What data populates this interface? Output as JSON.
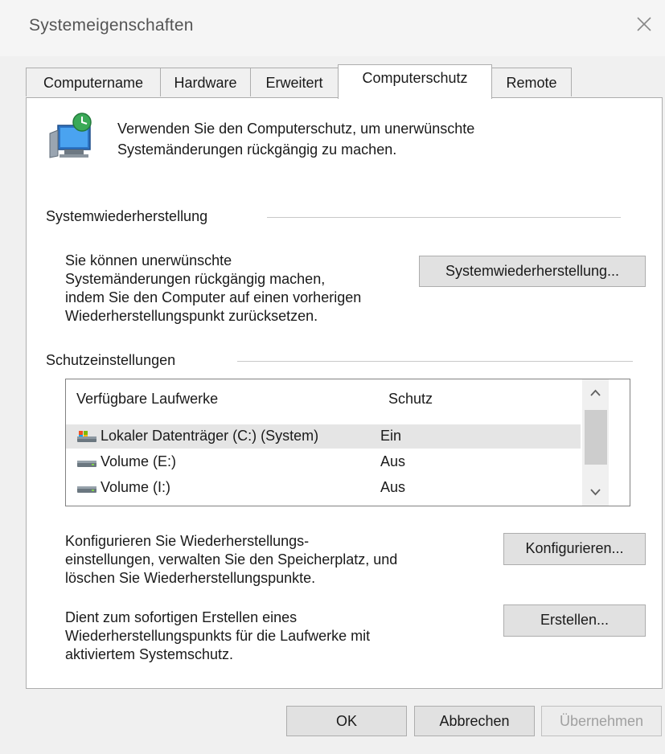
{
  "window": {
    "title": "Systemeigenschaften"
  },
  "tabs": [
    {
      "label": "Computername"
    },
    {
      "label": "Hardware"
    },
    {
      "label": "Erweitert"
    },
    {
      "label": "Computerschutz",
      "active": true
    },
    {
      "label": "Remote"
    }
  ],
  "intro": {
    "text_line1": "Verwenden Sie den Computerschutz, um unerwünschte",
    "text_line2": "Systemänderungen rückgängig zu machen."
  },
  "restore": {
    "group_label": "Systemwiederherstellung",
    "line1": "Sie können unerwünschte",
    "line2": "Systemänderungen rückgängig machen,",
    "line3": "indem Sie den Computer auf einen vorherigen",
    "line4": "Wiederherstellungspunkt zurücksetzen.",
    "button_label": "Systemwiederherstellung..."
  },
  "protection": {
    "group_label": "Schutzeinstellungen",
    "columns": {
      "drives": "Verfügbare Laufwerke",
      "status": "Schutz"
    },
    "drives": [
      {
        "name": "Lokaler Datenträger (C:) (System)",
        "status": "Ein",
        "icon": "system-drive-icon",
        "selected": true
      },
      {
        "name": "Volume (E:)",
        "status": "Aus",
        "icon": "drive-icon"
      },
      {
        "name": "Volume (I:)",
        "status": "Aus",
        "icon": "drive-icon"
      }
    ]
  },
  "configure": {
    "line1": "Konfigurieren Sie Wiederherstellungs-",
    "line2": "einstellungen, verwalten Sie den Speicherplatz, und",
    "line3": "löschen Sie Wiederherstellungspunkte.",
    "button_label": "Konfigurieren..."
  },
  "create": {
    "line1": "Dient zum sofortigen Erstellen eines",
    "line2": "Wiederherstellungspunkts für die Laufwerke mit",
    "line3": "aktiviertem Systemschutz.",
    "button_label": "Erstellen..."
  },
  "footer": {
    "ok_label": "OK",
    "cancel_label": "Abbrechen",
    "apply_label": "Übernehmen"
  },
  "colors": {
    "accent": "#0078d7",
    "disabled_text": "#a0a0a0"
  }
}
